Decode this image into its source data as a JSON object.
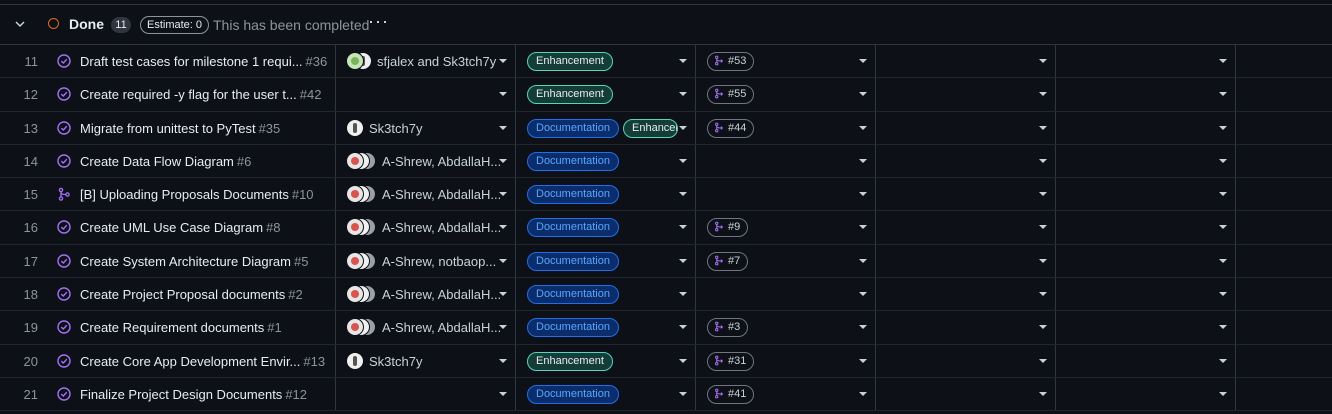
{
  "group": {
    "title": "Done",
    "count": "11",
    "estimate": "Estimate: 0",
    "description": "This has been completed",
    "more": "···",
    "status_color": "#db6d28"
  },
  "rows": [
    {
      "num": "11",
      "title": "Draft test cases for milestone 1 requi...",
      "issue": "#36",
      "icon": "issue-closed",
      "assignees": "sfjalex and Sk3tch7y",
      "labels": [
        "Enhancement"
      ],
      "pr": "#53"
    },
    {
      "num": "12",
      "title": "Create required -y flag for the user t...",
      "issue": "#42",
      "icon": "issue-closed",
      "assignees": "",
      "labels": [
        "Enhancement"
      ],
      "pr": "#55"
    },
    {
      "num": "13",
      "title": "Migrate from unittest to PyTest",
      "issue": "#35",
      "icon": "issue-closed",
      "assignees": "Sk3tch7y",
      "labels": [
        "Documentation",
        "Enhancement"
      ],
      "pr": "#44"
    },
    {
      "num": "14",
      "title": "Create Data Flow Diagram",
      "issue": "#6",
      "icon": "issue-closed",
      "assignees": "A-Shrew, AbdallaH...",
      "labels": [
        "Documentation"
      ],
      "pr": ""
    },
    {
      "num": "15",
      "title": "[B] Uploading Proposals Documents",
      "issue": "#10",
      "icon": "pr-merged",
      "assignees": "A-Shrew, AbdallaH...",
      "labels": [
        "Documentation"
      ],
      "pr": ""
    },
    {
      "num": "16",
      "title": "Create UML Use Case Diagram",
      "issue": "#8",
      "icon": "issue-closed",
      "assignees": "A-Shrew, AbdallaH...",
      "labels": [
        "Documentation"
      ],
      "pr": "#9"
    },
    {
      "num": "17",
      "title": "Create System Architecture Diagram",
      "issue": "#5",
      "icon": "issue-closed",
      "assignees": "A-Shrew, notbaop...",
      "labels": [
        "Documentation"
      ],
      "pr": "#7"
    },
    {
      "num": "18",
      "title": "Create Project Proposal documents",
      "issue": "#2",
      "icon": "issue-closed",
      "assignees": "A-Shrew, AbdallaH...",
      "labels": [
        "Documentation"
      ],
      "pr": ""
    },
    {
      "num": "19",
      "title": "Create Requirement documents",
      "issue": "#1",
      "icon": "issue-closed",
      "assignees": "A-Shrew, AbdallaH...",
      "labels": [
        "Documentation"
      ],
      "pr": "#3"
    },
    {
      "num": "20",
      "title": "Create Core App Development Envir...",
      "issue": "#13",
      "icon": "issue-closed",
      "assignees": "Sk3tch7y",
      "labels": [
        "Enhancement"
      ],
      "pr": "#31"
    },
    {
      "num": "21",
      "title": "Finalize Project Design Documents",
      "issue": "#12",
      "icon": "issue-closed",
      "assignees": "",
      "labels": [
        "Documentation"
      ],
      "pr": "#41"
    }
  ]
}
